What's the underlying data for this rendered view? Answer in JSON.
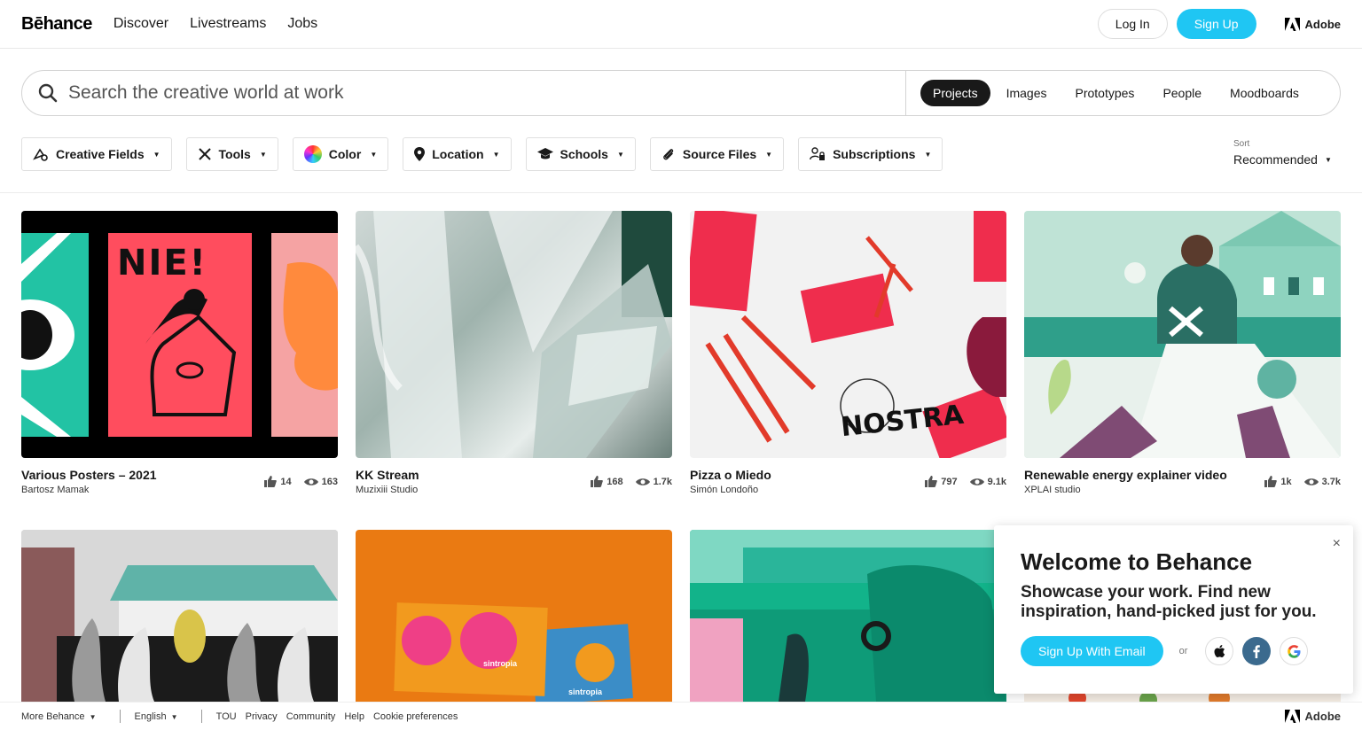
{
  "nav": {
    "logo": "Bēhance",
    "links": [
      "Discover",
      "Livestreams",
      "Jobs"
    ],
    "login": "Log In",
    "signup": "Sign Up",
    "adobe": "Adobe"
  },
  "search": {
    "placeholder": "Search the creative world at work",
    "tabs": [
      "Projects",
      "Images",
      "Prototypes",
      "People",
      "Moodboards"
    ],
    "active_tab": "Projects"
  },
  "filters": [
    "Creative Fields",
    "Tools",
    "Color",
    "Location",
    "Schools",
    "Source Files",
    "Subscriptions"
  ],
  "sort": {
    "label": "Sort",
    "value": "Recommended"
  },
  "projects": [
    {
      "title": "Various Posters – 2021",
      "owner": "Bartosz Mamak",
      "likes": "14",
      "views": "163"
    },
    {
      "title": "KK Stream",
      "owner": "Muzixiii Studio",
      "likes": "168",
      "views": "1.7k"
    },
    {
      "title": "Pizza o Miedo",
      "owner": "Simón Londoño",
      "likes": "797",
      "views": "9.1k"
    },
    {
      "title": "Renewable energy explainer video",
      "owner": "XPLAI studio",
      "likes": "1k",
      "views": "3.7k"
    }
  ],
  "thumb_text": {
    "poster": "NIE!",
    "nostra": "NOSTRA",
    "sintropia": "sintropia"
  },
  "popup": {
    "title": "Welcome to Behance",
    "body": "Showcase your work. Find new inspiration, hand-picked just for you.",
    "email_button": "Sign Up With Email",
    "or": "or",
    "close": "×"
  },
  "footer": {
    "more": "More Behance",
    "language": "English",
    "links": [
      "TOU",
      "Privacy",
      "Community",
      "Help",
      "Cookie preferences"
    ],
    "adobe": "Adobe"
  },
  "colors": {
    "accent": "#1fc6f3",
    "text": "#191919"
  }
}
